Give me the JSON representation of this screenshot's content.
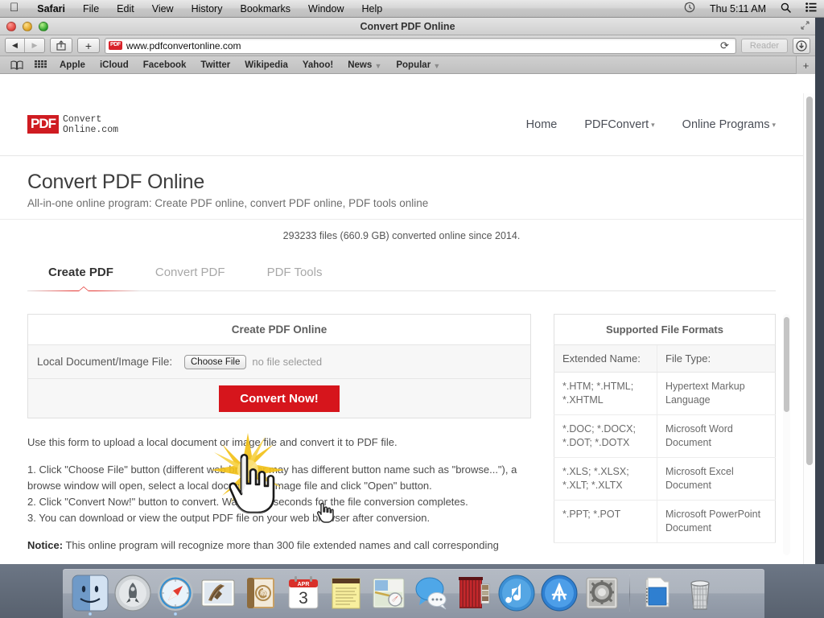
{
  "menubar": {
    "apple_icon": "apple-logo",
    "items": [
      "Safari",
      "File",
      "Edit",
      "View",
      "History",
      "Bookmarks",
      "Window",
      "Help"
    ],
    "clock_icon": "clock-icon",
    "time": "Thu 5:11 AM",
    "search_icon": "search-icon",
    "list_icon": "notification-center-icon"
  },
  "window": {
    "title": "Convert PDF Online",
    "close_label": "",
    "minimize_label": "",
    "zoom_label": "",
    "fullscreen_icon": "fullscreen-icon"
  },
  "toolbar": {
    "back_icon": "back-arrow-icon",
    "forward_icon": "forward-arrow-icon",
    "share_icon": "share-icon",
    "new_tab_label": "+",
    "favicon_label": "PDF",
    "url": "www.pdfconvertonline.com",
    "reload_icon": "reload-icon",
    "reader_label": "Reader",
    "downloads_icon": "downloads-icon"
  },
  "bookmarks": {
    "sidebar_icon": "book-sidebar-icon",
    "topsites_icon": "top-sites-grid-icon",
    "items": [
      {
        "label": "Apple",
        "caret": false
      },
      {
        "label": "iCloud",
        "caret": false
      },
      {
        "label": "Facebook",
        "caret": false
      },
      {
        "label": "Twitter",
        "caret": false
      },
      {
        "label": "Wikipedia",
        "caret": false
      },
      {
        "label": "Yahoo!",
        "caret": false
      },
      {
        "label": "News",
        "caret": true
      },
      {
        "label": "Popular",
        "caret": true
      }
    ],
    "add_tab_label": "+"
  },
  "site": {
    "logo": {
      "badge": "PDF",
      "line1": "Convert",
      "line2": "Online.com"
    },
    "nav": [
      {
        "label": "Home",
        "caret": false
      },
      {
        "label": "PDFConvert",
        "caret": true
      },
      {
        "label": "Online Programs",
        "caret": true
      }
    ],
    "hero": {
      "title": "Convert PDF Online",
      "subtitle": "All-in-one online program: Create PDF online, convert PDF online, PDF tools online"
    },
    "counter": "293233 files (660.9 GB) converted online since 2014.",
    "tabs": [
      {
        "label": "Create PDF",
        "active": true
      },
      {
        "label": "Convert PDF",
        "active": false
      },
      {
        "label": "PDF Tools",
        "active": false
      }
    ],
    "form": {
      "title": "Create PDF Online",
      "file_label": "Local Document/Image File:",
      "choose_button": "Choose File",
      "file_status": "no file selected",
      "submit_button": "Convert Now!"
    },
    "instructions": {
      "intro": "Use this form to upload a local document or image file and convert it to PDF file.",
      "steps": [
        "1. Click \"Choose File\" button (different web browser may has different button name such as \"browse...\"), a browse window will open, select a local document or image file and click \"Open\" button.",
        "2. Click \"Convert Now!\" button to convert. Wait a few seconds for the file conversion completes.",
        "3. You can download or view the output PDF file on your web browser after conversion."
      ],
      "notice_label": "Notice:",
      "notice_text": "This online program will recognize more than 300 file extended names and call corresponding"
    },
    "formats": {
      "caption": "Supported File Formats",
      "headers": [
        "Extended Name:",
        "File Type:"
      ],
      "rows": [
        [
          "*.HTM; *.HTML; *.XHTML",
          "Hypertext Markup Language"
        ],
        [
          "*.DOC; *.DOCX; *.DOT; *.DOTX",
          "Microsoft Word Document"
        ],
        [
          "*.XLS; *.XLSX; *.XLT; *.XLTX",
          "Microsoft Excel Document"
        ],
        [
          "*.PPT; *.POT",
          "Microsoft PowerPoint Document"
        ]
      ]
    },
    "colors": {
      "brand_red": "#cf1b21",
      "button_red": "#d6151c",
      "tab_underline": "#e53935"
    }
  },
  "overlay": {
    "starburst_icon": "starburst-highlight-icon",
    "hand_icon": "pointing-hand-cursor-icon",
    "cursor_icon": "hand-pointer-cursor-icon"
  },
  "dock": {
    "items": [
      {
        "name": "finder",
        "running": true
      },
      {
        "name": "launchpad",
        "running": false
      },
      {
        "name": "safari",
        "running": true
      },
      {
        "name": "mail",
        "running": false
      },
      {
        "name": "contacts",
        "running": false
      },
      {
        "name": "calendar",
        "running": false
      },
      {
        "name": "notes",
        "running": false
      },
      {
        "name": "maps",
        "running": false
      },
      {
        "name": "messages",
        "running": false
      },
      {
        "name": "photo-booth",
        "running": false
      },
      {
        "name": "itunes",
        "running": false
      },
      {
        "name": "app-store",
        "running": false
      },
      {
        "name": "system-preferences",
        "running": false
      },
      {
        "name": "documents-folder",
        "running": false
      },
      {
        "name": "trash",
        "running": false
      }
    ],
    "calendar_month": "APR",
    "calendar_day": "3"
  }
}
